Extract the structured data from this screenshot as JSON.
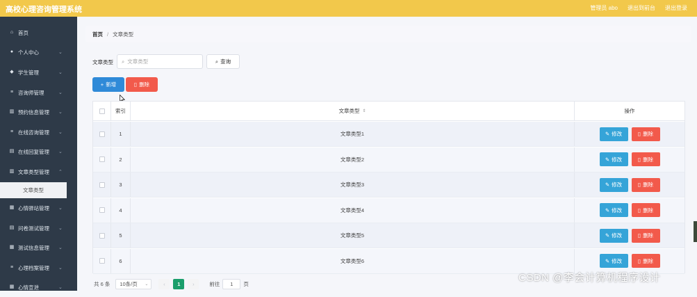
{
  "header": {
    "title": "高校心理咨询管理系统",
    "user_label": "管理员 abo",
    "exit_to_front": "退出到前台",
    "logout": "退出登录"
  },
  "sidebar": {
    "items": [
      {
        "label": "首页",
        "icon": "home-icon",
        "has_children": false
      },
      {
        "label": "个人中心",
        "icon": "user-icon",
        "has_children": true
      },
      {
        "label": "学生管理",
        "icon": "location-icon",
        "has_children": true
      },
      {
        "label": "咨询师管理",
        "icon": "list-icon",
        "has_children": true
      },
      {
        "label": "预约信息管理",
        "icon": "chart-icon",
        "has_children": true
      },
      {
        "label": "在线咨询管理",
        "icon": "list-icon",
        "has_children": true
      },
      {
        "label": "在线回复管理",
        "icon": "document-icon",
        "has_children": true
      },
      {
        "label": "文章类型管理",
        "icon": "chart-icon",
        "has_children": true
      },
      {
        "label": "心情驿站管理",
        "icon": "grid-icon",
        "has_children": true
      },
      {
        "label": "问卷测试管理",
        "icon": "document-icon",
        "has_children": true
      },
      {
        "label": "测试信息管理",
        "icon": "grid-icon",
        "has_children": true
      },
      {
        "label": "心理档案管理",
        "icon": "list-icon",
        "has_children": true
      },
      {
        "label": "心情宣泄",
        "icon": "grid-icon",
        "has_children": true
      }
    ],
    "active_sub": "文章类型"
  },
  "breadcrumb": {
    "home": "首页",
    "separator": "/",
    "current": "文章类型"
  },
  "filter": {
    "label": "文章类型",
    "placeholder": "文章类型",
    "search_button": "查询"
  },
  "actions": {
    "add": "新增",
    "delete": "删除"
  },
  "table": {
    "headers": {
      "index": "索引",
      "type": "文章类型",
      "ops": "操作"
    },
    "rows": [
      {
        "index": "1",
        "type": "文章类型1"
      },
      {
        "index": "2",
        "type": "文章类型2"
      },
      {
        "index": "3",
        "type": "文章类型3"
      },
      {
        "index": "4",
        "type": "文章类型4"
      },
      {
        "index": "5",
        "type": "文章类型5"
      },
      {
        "index": "6",
        "type": "文章类型6"
      }
    ],
    "edit_label": "修改",
    "delete_label": "删除"
  },
  "pagination": {
    "total": "共 6 条",
    "page_size": "10条/页",
    "current_page": "1",
    "goto_label": "前往",
    "goto_value": "1",
    "page_suffix": "页"
  },
  "watermark": "CSDN @李会计算机程序设计",
  "colors": {
    "header_bg": "#f2c84b",
    "sidebar_bg": "#2e3a48",
    "primary": "#2f8ad8",
    "danger": "#f25a4b",
    "edit": "#35a4d8",
    "pager_active": "#1a9e6b"
  }
}
